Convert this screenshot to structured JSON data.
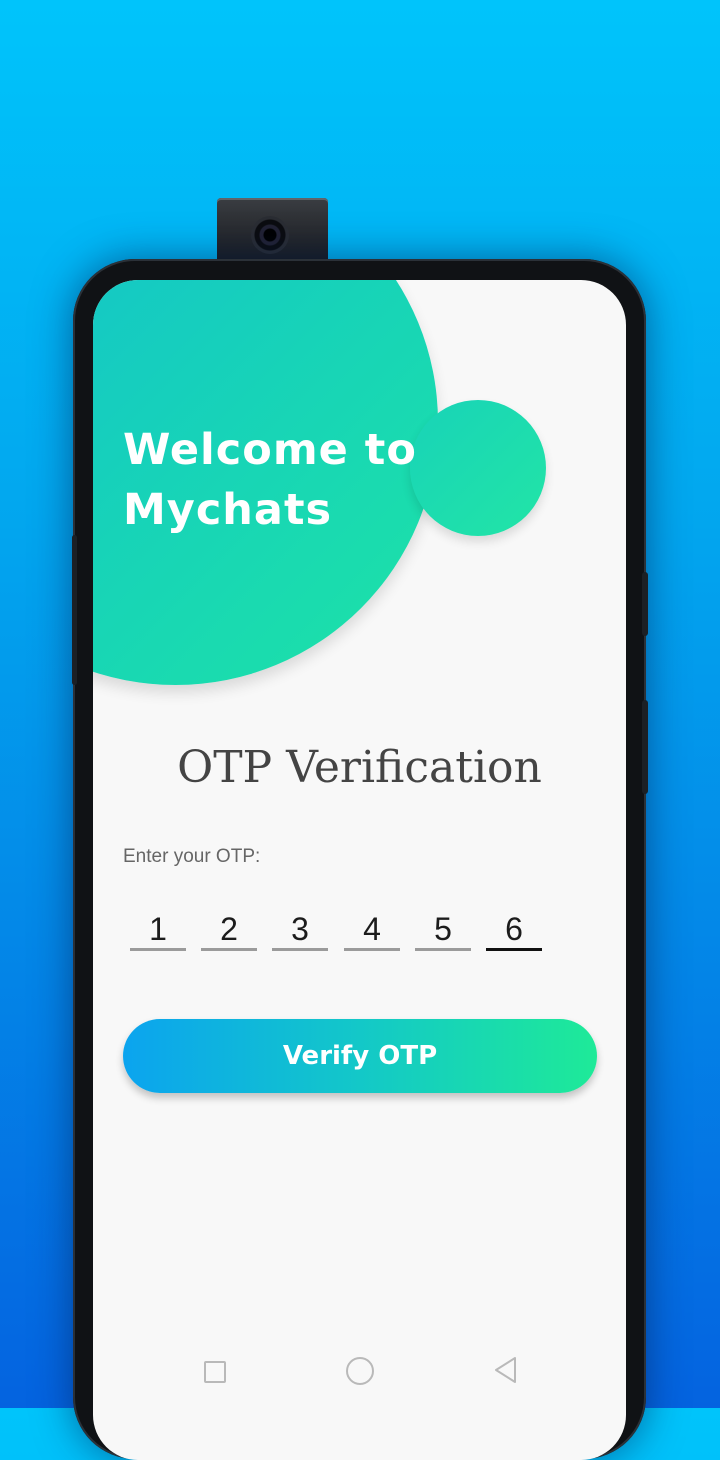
{
  "header": {
    "welcome_line1": "Welcome to",
    "welcome_line2": "Mychats"
  },
  "main": {
    "title": "OTP Verification",
    "otp_label": "Enter your OTP:",
    "otp_digits": [
      "1",
      "2",
      "3",
      "4",
      "5",
      "6"
    ],
    "verify_button": "Verify OTP"
  },
  "navbar": {
    "recents_icon": "square-icon",
    "home_icon": "circle-icon",
    "back_icon": "triangle-back-icon"
  },
  "colors": {
    "background_top": "#00c4fb",
    "background_bottom": "#0463e0",
    "accent_teal": "#17d3b8",
    "button_start": "#0ba4ef",
    "button_end": "#1eea98"
  }
}
